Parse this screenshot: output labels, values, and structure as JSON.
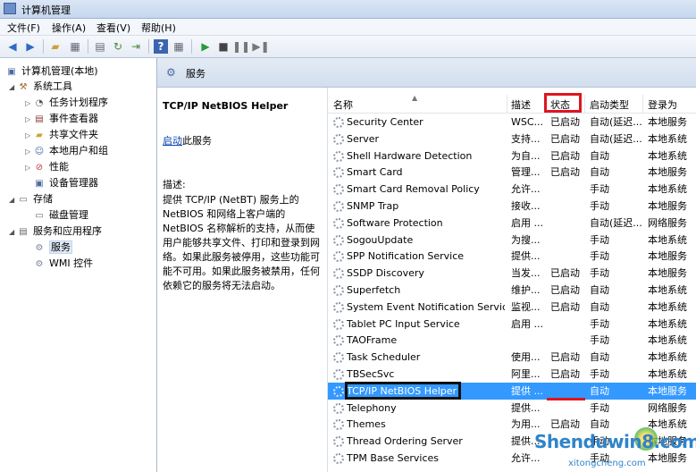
{
  "window": {
    "title": "计算机管理"
  },
  "menu": [
    "文件(F)",
    "操作(A)",
    "查看(V)",
    "帮助(H)"
  ],
  "toolbar_icons": [
    "back-arrow-icon",
    "forward-arrow-icon",
    "up-folder-icon",
    "show-hide-tree-icon",
    "properties-icon",
    "export-list-icon",
    "refresh-icon",
    "help-icon",
    "show-hide-action-icon",
    "play-icon",
    "stop-icon",
    "pause-icon",
    "restart-icon"
  ],
  "tree": [
    {
      "label": "计算机管理(本地)",
      "level": 0,
      "expander": "",
      "icon": "computer-icon"
    },
    {
      "label": "系统工具",
      "level": 1,
      "expander": "◢",
      "icon": "tools-icon"
    },
    {
      "label": "任务计划程序",
      "level": 2,
      "expander": "▷",
      "icon": "clock-icon"
    },
    {
      "label": "事件查看器",
      "level": 2,
      "expander": "▷",
      "icon": "event-viewer-icon"
    },
    {
      "label": "共享文件夹",
      "level": 2,
      "expander": "▷",
      "icon": "shared-folder-icon"
    },
    {
      "label": "本地用户和组",
      "level": 2,
      "expander": "▷",
      "icon": "users-icon"
    },
    {
      "label": "性能",
      "level": 2,
      "expander": "▷",
      "icon": "performance-icon"
    },
    {
      "label": "设备管理器",
      "level": 2,
      "expander": "",
      "icon": "device-manager-icon"
    },
    {
      "label": "存储",
      "level": 1,
      "expander": "◢",
      "icon": "storage-icon"
    },
    {
      "label": "磁盘管理",
      "level": 2,
      "expander": "",
      "icon": "disk-icon"
    },
    {
      "label": "服务和应用程序",
      "level": 1,
      "expander": "◢",
      "icon": "services-apps-icon"
    },
    {
      "label": "服务",
      "level": 2,
      "expander": "",
      "icon": "services-gear-icon",
      "selected": true
    },
    {
      "label": "WMI 控件",
      "level": 2,
      "expander": "",
      "icon": "wmi-icon"
    }
  ],
  "header": {
    "title": "服务"
  },
  "detail": {
    "service_name": "TCP/IP NetBIOS Helper",
    "start_link": "启动",
    "start_suffix": "此服务",
    "desc_label": "描述:",
    "desc_text": "提供 TCP/IP (NetBT) 服务上的 NetBIOS 和网络上客户端的 NetBIOS 名称解析的支持，从而使用户能够共享文件、打印和登录到网络。如果此服务被停用，这些功能可能不可用。如果此服务被禁用，任何依赖它的服务将无法启动。"
  },
  "columns": [
    "名称",
    "描述",
    "状态",
    "启动类型",
    "登录为"
  ],
  "rows": [
    {
      "name": "Security Center",
      "desc": "WSC...",
      "status": "已启动",
      "startup": "自动(延迟...",
      "logon": "本地服务"
    },
    {
      "name": "Server",
      "desc": "支持...",
      "status": "已启动",
      "startup": "自动(延迟...",
      "logon": "本地系统"
    },
    {
      "name": "Shell Hardware Detection",
      "desc": "为自...",
      "status": "已启动",
      "startup": "自动",
      "logon": "本地系统"
    },
    {
      "name": "Smart Card",
      "desc": "管理...",
      "status": "已启动",
      "startup": "自动",
      "logon": "本地服务"
    },
    {
      "name": "Smart Card Removal Policy",
      "desc": "允许...",
      "status": "",
      "startup": "手动",
      "logon": "本地系统"
    },
    {
      "name": "SNMP Trap",
      "desc": "接收...",
      "status": "",
      "startup": "手动",
      "logon": "本地服务"
    },
    {
      "name": "Software Protection",
      "desc": "启用 ...",
      "status": "",
      "startup": "自动(延迟...",
      "logon": "网络服务"
    },
    {
      "name": "SogouUpdate",
      "desc": "为搜...",
      "status": "",
      "startup": "手动",
      "logon": "本地系统"
    },
    {
      "name": "SPP Notification Service",
      "desc": "提供...",
      "status": "",
      "startup": "手动",
      "logon": "本地服务"
    },
    {
      "name": "SSDP Discovery",
      "desc": "当发...",
      "status": "已启动",
      "startup": "手动",
      "logon": "本地服务"
    },
    {
      "name": "Superfetch",
      "desc": "维护...",
      "status": "已启动",
      "startup": "自动",
      "logon": "本地系统"
    },
    {
      "name": "System Event Notification Service",
      "desc": "监视...",
      "status": "已启动",
      "startup": "自动",
      "logon": "本地系统"
    },
    {
      "name": "Tablet PC Input Service",
      "desc": "启用 ...",
      "status": "",
      "startup": "手动",
      "logon": "本地系统"
    },
    {
      "name": "TAOFrame",
      "desc": "",
      "status": "",
      "startup": "手动",
      "logon": "本地系统"
    },
    {
      "name": "Task Scheduler",
      "desc": "使用...",
      "status": "已启动",
      "startup": "自动",
      "logon": "本地系统"
    },
    {
      "name": "TBSecSvc",
      "desc": "阿里...",
      "status": "已启动",
      "startup": "手动",
      "logon": "本地系统"
    },
    {
      "name": "TCP/IP NetBIOS Helper",
      "desc": "提供 ...",
      "status": "",
      "startup": "自动",
      "logon": "本地服务",
      "selected": true
    },
    {
      "name": "Telephony",
      "desc": "提供...",
      "status": "",
      "startup": "手动",
      "logon": "网络服务"
    },
    {
      "name": "Themes",
      "desc": "为用...",
      "status": "已启动",
      "startup": "自动",
      "logon": "本地系统"
    },
    {
      "name": "Thread Ordering Server",
      "desc": "提供...",
      "status": "",
      "startup": "手动",
      "logon": "本地服务"
    },
    {
      "name": "TPM Base Services",
      "desc": "允许...",
      "status": "",
      "startup": "手动",
      "logon": "本地服务"
    }
  ],
  "watermark": {
    "line1": "Shenduwin8.com",
    "line2": "xitongcheng.com"
  },
  "colors": {
    "selection": "#3399ff",
    "annotation_red": "#e0141e",
    "annotation_black": "#111111"
  }
}
